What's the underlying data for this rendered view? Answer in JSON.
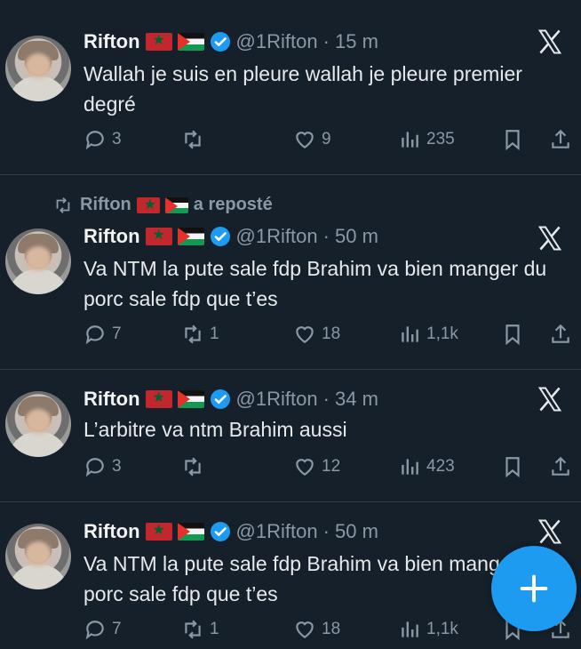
{
  "tweets": [
    {
      "name": "Rifton",
      "handle": "@1Rifton",
      "time": "· 15 m",
      "text": "Wallah je suis en pleure wallah je pleure premier degré",
      "replies": "3",
      "reposts": "",
      "likes": "9",
      "views": "235",
      "repost_label": ""
    },
    {
      "name": "Rifton",
      "handle": "@1Rifton",
      "time": "· 50 m",
      "text": "Va NTM la pute sale fdp Brahim va bien manger du porc sale fdp que t’es",
      "replies": "7",
      "reposts": "1",
      "likes": "18",
      "views": "1,1k",
      "repost_by": "Rifton",
      "repost_label": "a reposté"
    },
    {
      "name": "Rifton",
      "handle": "@1Rifton",
      "time": "· 34 m",
      "text": "L’arbitre va ntm Brahim aussi",
      "replies": "3",
      "reposts": "",
      "likes": "12",
      "views": "423",
      "repost_label": ""
    },
    {
      "name": "Rifton",
      "handle": "@1Rifton",
      "time": "· 50 m",
      "text": "Va NTM la pute sale fdp Brahim va bien manger du porc sale fdp que t’es",
      "replies": "7",
      "reposts": "1",
      "likes": "18",
      "views": "1,1k",
      "repost_label": ""
    }
  ],
  "icons": {
    "reply": "reply-icon",
    "repost": "repost-icon",
    "like": "heart-icon",
    "views": "views-icon",
    "bookmark": "bookmark-icon",
    "share": "share-icon",
    "platform": "x-logo-icon",
    "compose": "plus-icon"
  },
  "colors": {
    "background": "#15202b",
    "accent": "#1d9bf0",
    "muted": "#8b98a5",
    "text": "#e7e9ea"
  }
}
